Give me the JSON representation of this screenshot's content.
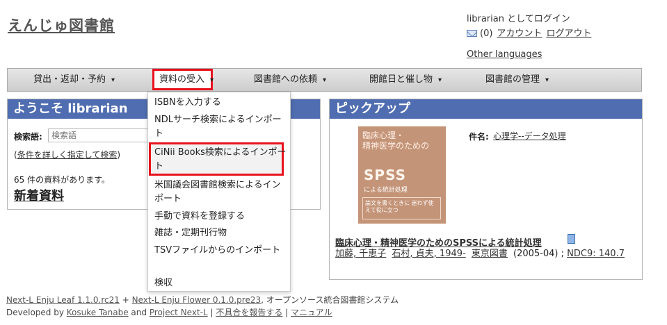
{
  "header": {
    "site_title": "えんじゅ図書館",
    "login_status": "librarian としてログイン",
    "message_count": "(0)",
    "account_link": "アカウント",
    "logout_link": "ログアウト",
    "other_languages": "Other languages"
  },
  "nav": {
    "items": [
      {
        "label": "貸出・返却・予約"
      },
      {
        "label": "資料の受入"
      },
      {
        "label": "図書館への依頼"
      },
      {
        "label": "開館日と催し物"
      },
      {
        "label": "図書館の管理"
      }
    ],
    "caret": "▾"
  },
  "dropdown": {
    "items": [
      {
        "label": "ISBNを入力する"
      },
      {
        "label": "NDLサーチ検索によるインポート"
      },
      {
        "label": "CiNii Books検索によるインポート"
      },
      {
        "label": "米国議会図書館検索によるインポート"
      },
      {
        "label": "手動で資料を登録する"
      },
      {
        "label": "雑誌・定期刊行物"
      },
      {
        "label": "TSVファイルからのインポート"
      },
      {
        "label": "検収"
      }
    ]
  },
  "welcome": {
    "heading": "ようこそ librarian",
    "search_label": "検索語:",
    "search_placeholder": "検索語",
    "advanced_search": "(条件を詳しく指定して検索)",
    "adv_open": "(",
    "adv_link": "条件を詳しく指定して検索",
    "adv_close": ")",
    "count_text": "65 件の資料があります。",
    "new_items": "新着資料"
  },
  "pickup": {
    "heading": "ピックアップ",
    "subject_label": "件名:",
    "subject_value": "心理学--データ処理",
    "book_title": "臨床心理・精神医学のためのSPSSによる統計処理",
    "authors": [
      "加藤, 千恵子",
      "石村, 貞夫, 1949-"
    ],
    "publisher": "東京図書",
    "year": "(2005-04)",
    "separator": ";",
    "ndc": "NDC9: 140.7",
    "cover": {
      "line1": "臨床心理・",
      "line2": "精神医学のための",
      "spss": "SPSS",
      "sub": "による統計処理",
      "box": "論文を書くときに 迷わず使えて役に立つ"
    }
  },
  "footer": {
    "leaf": "Next-L Enju Leaf 1.1.0.rc21",
    "plus": " + ",
    "flower": "Next-L Enju Flower 0.1.0.pre23",
    "desc": ", オープンソース統合図書館システム",
    "developed_by": "Developed by ",
    "author": "Kosuke Tanabe",
    "and": " and ",
    "project": "Project Next-L",
    "sep": " | ",
    "report": "不具合を報告する",
    "manual": "マニュアル"
  },
  "colors": {
    "panel_header": "#4f6db0",
    "highlight": "#e8121c",
    "cover": "#c49478"
  }
}
